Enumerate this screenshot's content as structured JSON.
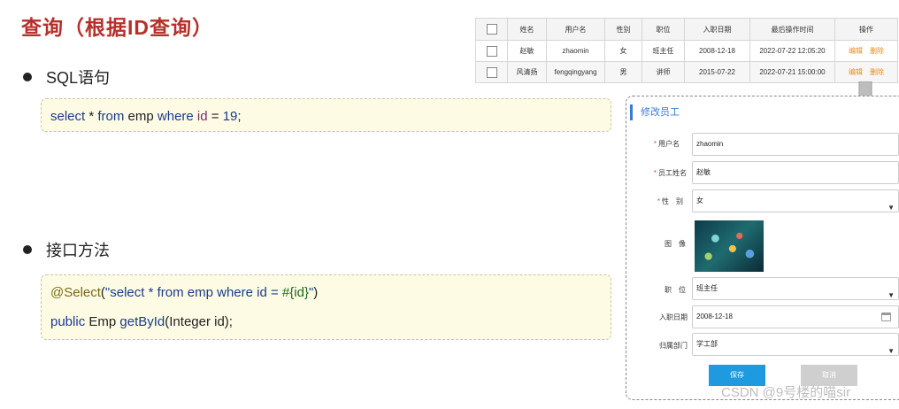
{
  "title": "查询（根据ID查询）",
  "bullets": [
    "SQL语句",
    "接口方法"
  ],
  "code1": {
    "p1": "select",
    "p2": " * ",
    "p3": "from",
    "p4": " emp ",
    "p5": "where",
    "p6": " ",
    "p7": "id",
    "p8": " = ",
    "p9": "19",
    "p10": ";"
  },
  "code2": {
    "line1": {
      "p1": "@Select",
      "p2": "(",
      "p3": "\"select * from emp where id = ",
      "p4": "#{id}",
      "p5": "\"",
      "p6": ")"
    },
    "line2": {
      "p1": "public",
      "p2": " Emp ",
      "p3": "getById",
      "p4": "(Integer id);"
    }
  },
  "table": {
    "headers": [
      "",
      "姓名",
      "用户名",
      "性别",
      "职位",
      "入职日期",
      "最后操作时间",
      "操作"
    ],
    "rows": [
      {
        "name": "赵敏",
        "username": "zhaomin",
        "gender": "女",
        "job": "班主任",
        "entry_date": "2008-12-18",
        "update_time": "2022-07-22 12:05:20",
        "edit": "编辑",
        "delete": "删除"
      },
      {
        "name": "风清扬",
        "username": "fengqingyang",
        "gender": "男",
        "job": "讲师",
        "entry_date": "2015-07-22",
        "update_time": "2022-07-21 15:00:00",
        "edit": "编辑",
        "delete": "删除"
      }
    ]
  },
  "form": {
    "title": "修改员工",
    "required_mark": "*",
    "fields": {
      "username": {
        "label": "用户名",
        "value": "zhaomin"
      },
      "name": {
        "label": "员工姓名",
        "value": "赵敏"
      },
      "gender": {
        "label": "性　别",
        "value": "女"
      },
      "image": {
        "label": "图　像"
      },
      "job": {
        "label": "职　位",
        "value": "班主任"
      },
      "entry_date": {
        "label": "入职日期",
        "value": "2008-12-18"
      },
      "dept": {
        "label": "归属部门",
        "value": "学工部"
      }
    },
    "save": "保存",
    "cancel": "取消"
  },
  "watermark": "CSDN @9号楼的喵sir",
  "colors": {
    "title": "#b5302a",
    "accent": "#3a7bd5",
    "save_button": "#1e9be0",
    "code_bg": "#fdfbe4"
  }
}
